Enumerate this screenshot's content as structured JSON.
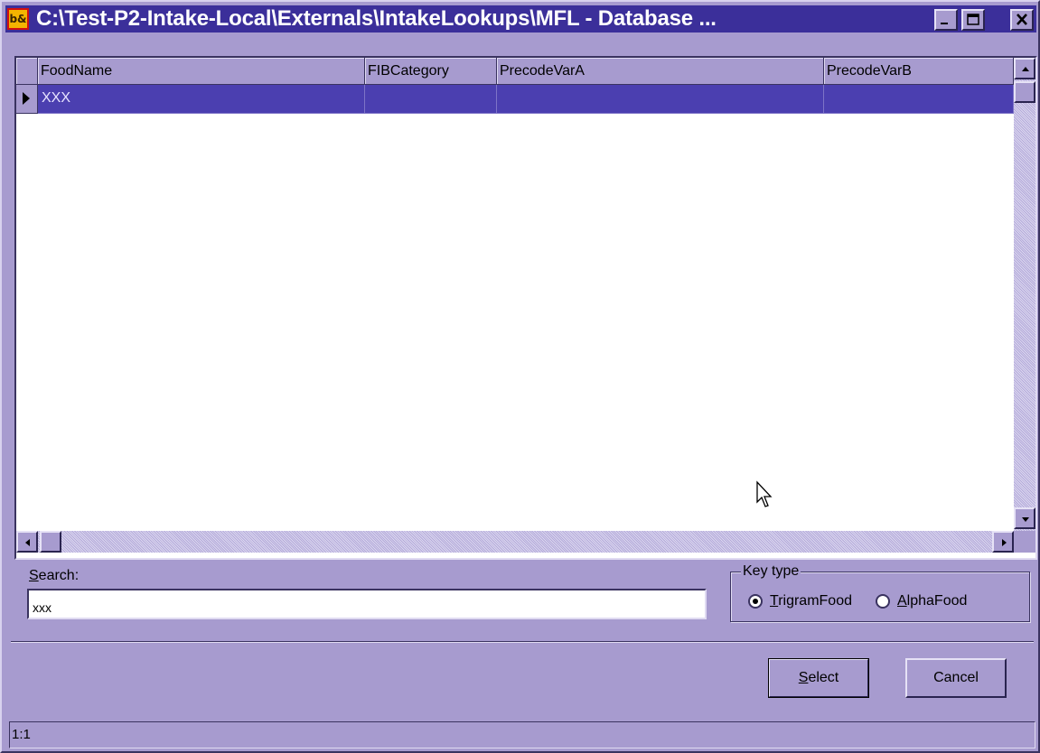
{
  "window": {
    "title": "C:\\Test-P2-Intake-Local\\Externals\\IntakeLookups\\MFL - Database ...",
    "icon_text": "b&"
  },
  "grid": {
    "columns": [
      "FoodName",
      "FIBCategory",
      "PrecodeVarA",
      "PrecodeVarB"
    ],
    "rows": [
      {
        "FoodName": "XXX",
        "FIBCategory": "",
        "PrecodeVarA": "",
        "PrecodeVarB": ""
      }
    ],
    "selected_row_color": "#4b3fb0"
  },
  "search": {
    "label_prefix": "",
    "label_accel": "S",
    "label_rest": "earch:",
    "value": "xxx"
  },
  "key_type": {
    "legend": "Key type",
    "options": [
      {
        "accel": "T",
        "rest": "rigramFood",
        "selected": true
      },
      {
        "accel": "A",
        "rest": "lphaFood",
        "selected": false
      }
    ]
  },
  "buttons": {
    "select_accel": "S",
    "select_rest": "elect",
    "cancel": "Cancel"
  },
  "status": {
    "position": "1:1"
  },
  "colors": {
    "titlebar": "#3b2f9a",
    "window": "#a79bcf"
  }
}
